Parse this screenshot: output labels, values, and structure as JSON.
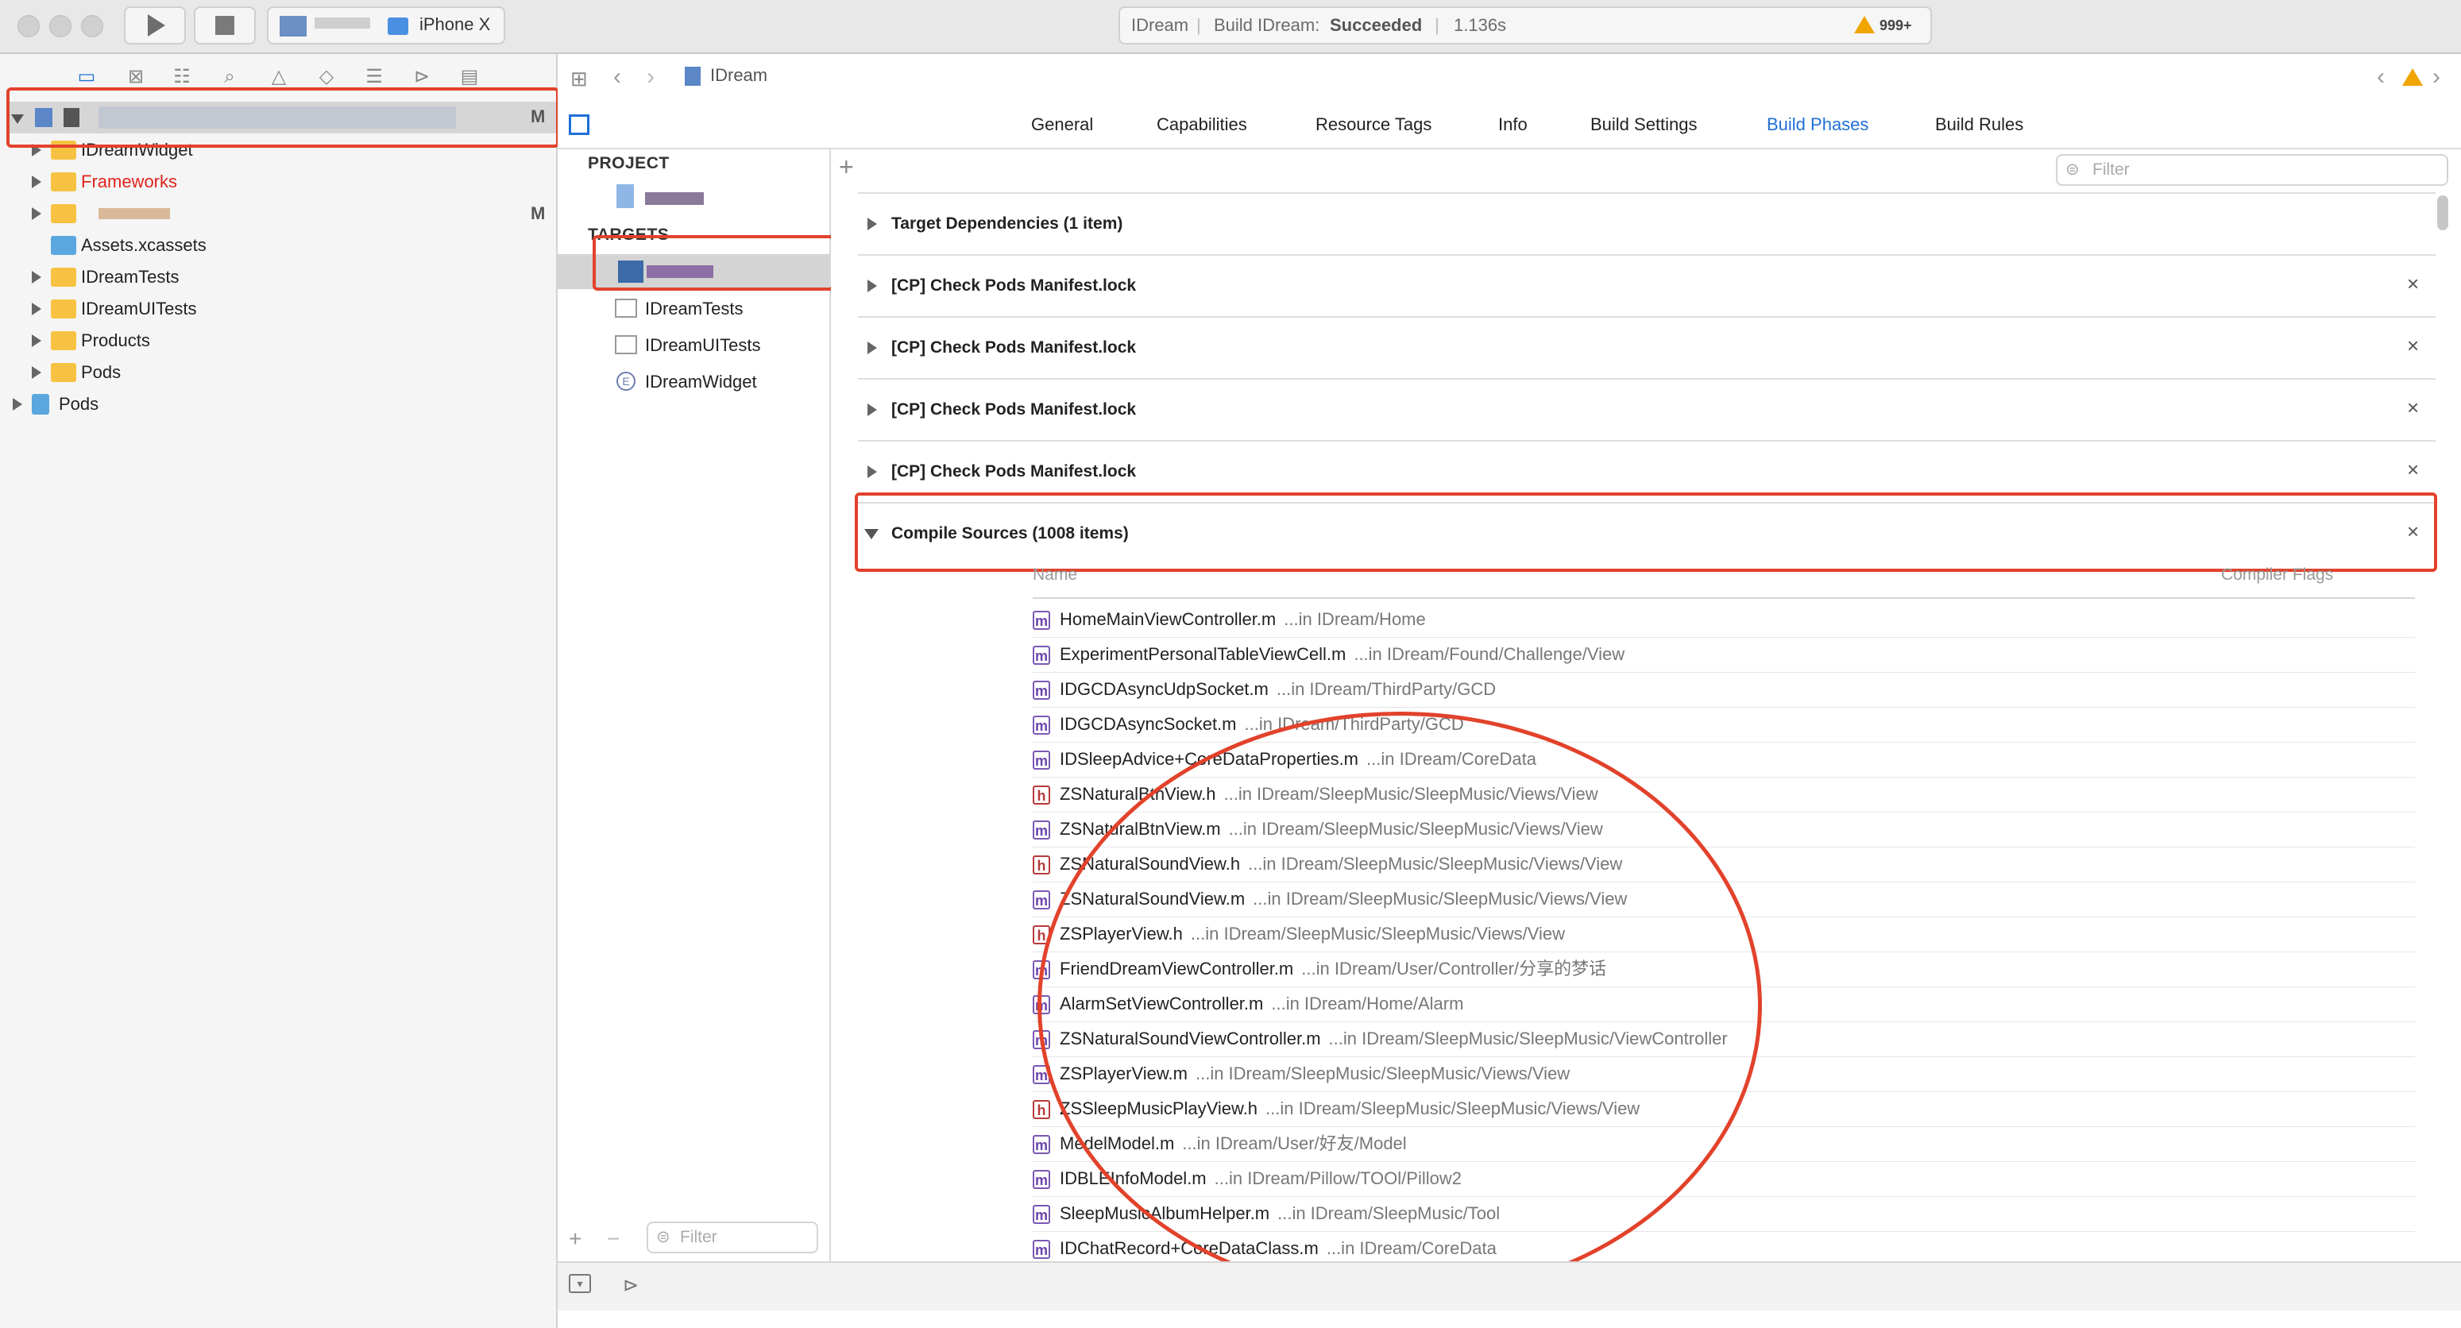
{
  "toolbar": {
    "scheme_device": "iPhone X",
    "status_project": "IDream",
    "status_build_prefix": "Build IDream:",
    "status_build_result": "Succeeded",
    "status_time": "1.136s",
    "warning_count": "999+"
  },
  "navigator": {
    "root_badge": "M",
    "items": [
      {
        "label": "IDreamWidget",
        "color": "#222"
      },
      {
        "label": "Frameworks",
        "color": "#e0231c"
      },
      {
        "label": "",
        "badge": "M"
      },
      {
        "label": "Assets.xcassets"
      },
      {
        "label": "IDreamTests"
      },
      {
        "label": "IDreamUITests"
      },
      {
        "label": "Products"
      },
      {
        "label": "Pods"
      },
      {
        "label": "Pods"
      }
    ]
  },
  "jumpbar": {
    "project": "IDream"
  },
  "tabs": [
    "General",
    "Capabilities",
    "Resource Tags",
    "Info",
    "Build Settings",
    "Build Phases",
    "Build Rules"
  ],
  "active_tab": "Build Phases",
  "filter_placeholder": "Filter",
  "targets_pane": {
    "project_header": "PROJECT",
    "targets_header": "TARGETS",
    "targets": [
      "IDreamTests",
      "IDreamUITests",
      "IDreamWidget"
    ],
    "widget_badge": "E",
    "filter_placeholder": "Filter"
  },
  "phases": [
    {
      "label": "Target Dependencies (1 item)",
      "removable": false
    },
    {
      "label": "[CP] Check Pods Manifest.lock",
      "removable": true
    },
    {
      "label": "[CP] Check Pods Manifest.lock",
      "removable": true
    },
    {
      "label": "[CP] Check Pods Manifest.lock",
      "removable": true
    },
    {
      "label": "[CP] Check Pods Manifest.lock",
      "removable": true
    },
    {
      "label": "Compile Sources (1008 items)",
      "removable": true,
      "expanded": true
    }
  ],
  "compile_sources": {
    "col_name": "Name",
    "col_flags": "Compiler Flags",
    "files": [
      {
        "type": "m",
        "name": "HomeMainViewController.m",
        "path": "...in IDream/Home"
      },
      {
        "type": "m",
        "name": "ExperimentPersonalTableViewCell.m",
        "path": "...in IDream/Found/Challenge/View"
      },
      {
        "type": "m",
        "name": "IDGCDAsyncUdpSocket.m",
        "path": "...in IDream/ThirdParty/GCD"
      },
      {
        "type": "m",
        "name": "IDGCDAsyncSocket.m",
        "path": "...in IDream/ThirdParty/GCD"
      },
      {
        "type": "m",
        "name": "IDSleepAdvice+CoreDataProperties.m",
        "path": "...in IDream/CoreData"
      },
      {
        "type": "h",
        "name": "ZSNaturalBtnView.h",
        "path": "...in IDream/SleepMusic/SleepMusic/Views/View"
      },
      {
        "type": "m",
        "name": "ZSNaturalBtnView.m",
        "path": "...in IDream/SleepMusic/SleepMusic/Views/View"
      },
      {
        "type": "h",
        "name": "ZSNaturalSoundView.h",
        "path": "...in IDream/SleepMusic/SleepMusic/Views/View"
      },
      {
        "type": "m",
        "name": "ZSNaturalSoundView.m",
        "path": "...in IDream/SleepMusic/SleepMusic/Views/View"
      },
      {
        "type": "h",
        "name": "ZSPlayerView.h",
        "path": "...in IDream/SleepMusic/SleepMusic/Views/View"
      },
      {
        "type": "m",
        "name": "FriendDreamViewController.m",
        "path": "...in IDream/User/Controller/分享的梦话"
      },
      {
        "type": "m",
        "name": "AlarmSetViewController.m",
        "path": "...in IDream/Home/Alarm"
      },
      {
        "type": "m",
        "name": "ZSNaturalSoundViewController.m",
        "path": "...in IDream/SleepMusic/SleepMusic/ViewController"
      },
      {
        "type": "m",
        "name": "ZSPlayerView.m",
        "path": "...in IDream/SleepMusic/SleepMusic/Views/View"
      },
      {
        "type": "h",
        "name": "ZSSleepMusicPlayView.h",
        "path": "...in IDream/SleepMusic/SleepMusic/Views/View"
      },
      {
        "type": "m",
        "name": "MedelModel.m",
        "path": "...in IDream/User/好友/Model"
      },
      {
        "type": "m",
        "name": "IDBLEInfoModel.m",
        "path": "...in IDream/Pillow/TOOl/Pillow2"
      },
      {
        "type": "m",
        "name": "SleepMusicAlbumHelper.m",
        "path": "...in IDream/SleepMusic/Tool"
      },
      {
        "type": "m",
        "name": "IDChatRecord+CoreDataClass.m",
        "path": "...in IDream/CoreData"
      }
    ]
  }
}
